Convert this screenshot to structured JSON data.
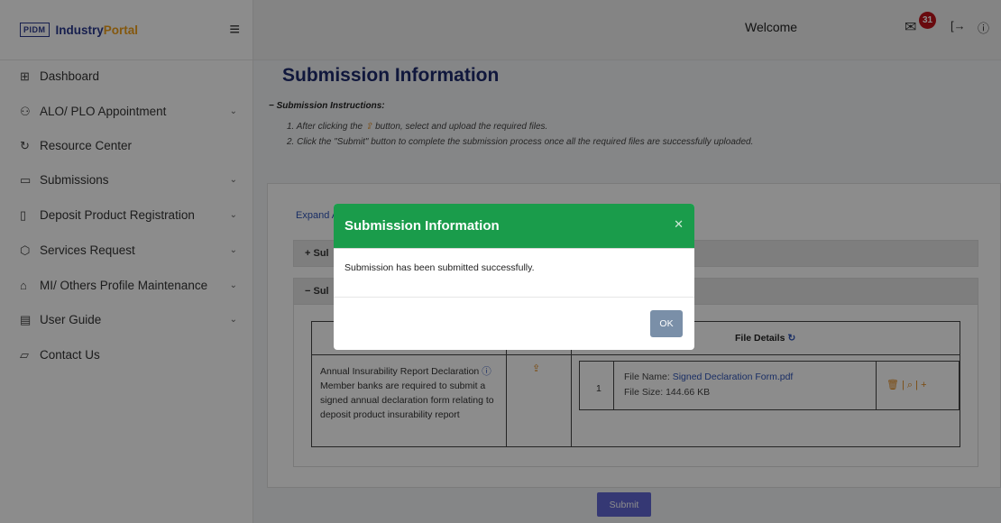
{
  "brand": {
    "logo_mark": "PIDM",
    "name_part1": "Industry",
    "name_part2": "Portal",
    "accent": "#f0a01b",
    "primary": "#2b3a8f"
  },
  "header": {
    "welcome": "Welcome",
    "notification_count": "31",
    "icons": [
      "mail-icon",
      "logout-icon",
      "help-icon"
    ]
  },
  "sidebar": {
    "items": [
      {
        "label": "Dashboard",
        "icon": "grid-icon",
        "has_children": false
      },
      {
        "label": "ALO/ PLO Appointment",
        "icon": "user-add-icon",
        "has_children": true
      },
      {
        "label": "Resource Center",
        "icon": "resource-icon",
        "has_children": false
      },
      {
        "label": "Submissions",
        "icon": "folder-icon",
        "has_children": true
      },
      {
        "label": "Deposit Product Registration",
        "icon": "document-icon",
        "has_children": true
      },
      {
        "label": "Services Request",
        "icon": "box-icon",
        "has_children": true
      },
      {
        "label": "MI/ Others Profile Maintenance",
        "icon": "home-icon",
        "has_children": true
      },
      {
        "label": "User Guide",
        "icon": "book-icon",
        "has_children": true
      },
      {
        "label": "Contact Us",
        "icon": "chat-icon",
        "has_children": false
      }
    ]
  },
  "main": {
    "title": "Submission Information",
    "instructions_title": "Submission Instructions:",
    "instruction_1_pre": "1. After clicking the",
    "instruction_1_post": "button, select and upload the required files.",
    "instruction_2": "2. Click the \"Submit\" button to complete the submission process once all the required files are successfully uploaded.",
    "expand_link": "Expand A",
    "section_1_label": "+ Sul",
    "section_2_label": "− Sul",
    "table": {
      "file_details_header": "File Details",
      "requirement_title": "Annual Insurability Report Declaration",
      "requirement_desc": "Member banks are required to submit a signed annual declaration form relating to deposit product insurability report",
      "row_number": "1",
      "file_name_label": "File Name:",
      "file_name": "Signed Declaration Form.pdf",
      "file_size": "File Size: 144.66 KB",
      "actions": "🗑 | ⌕ | +"
    },
    "submit_label": "Submit"
  },
  "modal": {
    "title": "Submission Information",
    "message": "Submission has been submitted successfully.",
    "ok_label": "OK",
    "header_color": "#1a9c4b"
  }
}
